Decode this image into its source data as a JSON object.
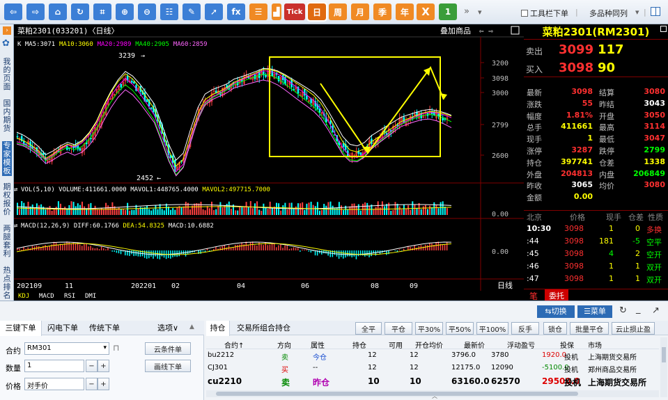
{
  "toolbar": {
    "buttons": [
      {
        "icon": "back-arrow-icon",
        "glyph": "⇦"
      },
      {
        "icon": "forward-arrow-icon",
        "glyph": "⇨"
      },
      {
        "icon": "home-icon",
        "glyph": "⌂"
      },
      {
        "icon": "refresh-icon",
        "glyph": "↻"
      },
      {
        "icon": "crop-icon",
        "glyph": "⌗"
      },
      {
        "icon": "zoom-in-icon",
        "glyph": "⊕"
      },
      {
        "icon": "zoom-out-icon",
        "glyph": "⊖"
      },
      {
        "icon": "formula-icon",
        "glyph": "☷"
      },
      {
        "icon": "draw-icon",
        "glyph": "✎"
      },
      {
        "icon": "cursor-icon",
        "glyph": "➚"
      },
      {
        "icon": "fx-icon",
        "glyph": "fx"
      },
      {
        "icon": "list-icon",
        "glyph": "☰"
      },
      {
        "icon": "chart-icon",
        "glyph": "▟"
      }
    ],
    "tick_label": "Tick",
    "periods": [
      "日",
      "周",
      "月",
      "季",
      "年"
    ],
    "x_label": "X",
    "one_label": "1",
    "more_label": "»",
    "more_dropdown": "▾",
    "toolbar_order": "工具栏下单",
    "multi_variety": "多品种同列",
    "multi_variety_dropdown": "▾"
  },
  "sidebar": {
    "items": [
      "我的页面",
      "国内期货",
      "专家模板",
      "期权报价",
      "两腿套利",
      "热点排名"
    ]
  },
  "chart": {
    "title": "菜粕2301(033201)〈日线〉",
    "overlay_label": "叠加商品",
    "ma_legend": [
      {
        "text": "K MA5:3071",
        "color": "#ffffff"
      },
      {
        "text": "MA10:3060",
        "color": "#ffff00"
      },
      {
        "text": "MA20:2989",
        "color": "#ff00ff"
      },
      {
        "text": "MA40:2905",
        "color": "#00ff00"
      },
      {
        "text": "MA60:2859",
        "color": "#ff66ff"
      }
    ],
    "high_label": "3239",
    "low_label": "2452",
    "price_ticks": [
      "3200",
      "3098",
      "3000",
      "2799",
      "2600"
    ],
    "vol_legend": [
      {
        "text": "VOL(5,10) VOLUME:411661.0000",
        "color": "#ffffff"
      },
      {
        "text": "MAVOL1:448765.4000",
        "color": "#ffffff"
      },
      {
        "text": "MAVOL2:497715.7000",
        "color": "#ffff00"
      }
    ],
    "vol_tick": "0.00",
    "macd_legend": [
      {
        "text": "MACD(12,26,9) DIFF:60.1766",
        "color": "#ffffff"
      },
      {
        "text": "DEA:54.8325",
        "color": "#ffff00"
      },
      {
        "text": "MACD:10.6882",
        "color": "#ffffff"
      }
    ],
    "macd_tick": "0.00",
    "x_labels": [
      "202109",
      "11",
      "202201",
      "02",
      "04",
      "06",
      "08",
      "09"
    ],
    "x_unit": "日线",
    "indicator_tabs": [
      "KDJ",
      "MACD",
      "RSI",
      "DMI"
    ]
  },
  "quote": {
    "name": "菜粕2301(RM2301)",
    "sell_label": "卖出",
    "sell_price": "3099",
    "sell_vol": "117",
    "buy_label": "买入",
    "buy_price": "3098",
    "buy_vol": "90",
    "rows": [
      [
        "最新",
        "3098",
        "结算",
        "3080"
      ],
      [
        "涨跌",
        "55",
        "昨结",
        "3043"
      ],
      [
        "幅度",
        "1.81%",
        "开盘",
        "3050"
      ],
      [
        "总手",
        "411661",
        "最高",
        "3114"
      ],
      [
        "现手",
        "1",
        "最低",
        "3047"
      ],
      [
        "涨停",
        "3287",
        "跌停",
        "2799"
      ],
      [
        "持仓",
        "397741",
        "仓差",
        "1338"
      ],
      [
        "外盘",
        "204813",
        "内盘",
        "206849"
      ],
      [
        "昨收",
        "3065",
        "均价",
        "3080"
      ],
      [
        "金额",
        "0.00",
        "",
        ""
      ]
    ],
    "tick_header": [
      "北京",
      "价格",
      "现手",
      "仓差",
      "性质"
    ],
    "ticks": [
      [
        "10:30",
        "3098",
        "1",
        "0",
        "多换"
      ],
      [
        ":44",
        "3098",
        "181",
        "-5",
        "空平"
      ],
      [
        ":45",
        "3098",
        "4",
        "2",
        "空开"
      ],
      [
        ":46",
        "3098",
        "1",
        "1",
        "双开"
      ],
      [
        ":47",
        "3098",
        "1",
        "1",
        "双开"
      ]
    ],
    "tab_pen": "笔",
    "tab_entrust": "委托"
  },
  "bottom": {
    "switch_label": "⇆切换",
    "menu_label": "☰菜单",
    "order_tabs": [
      "三键下单",
      "闪电下单",
      "传统下单"
    ],
    "options_label": "选项∨",
    "contract_label": "合约",
    "contract_value": "RM301",
    "qty_label": "数量",
    "qty_value": "1",
    "price_label": "价格",
    "price_value": "对手价",
    "cloud_order": "云条件单",
    "line_order": "画线下单",
    "pos_tabs": [
      "持仓",
      "交易所组合持仓"
    ],
    "actions": [
      "全平",
      "平仓",
      "平30%",
      "平50%",
      "平100%",
      "反手",
      "锁仓",
      "批量平仓",
      "云止损止盈"
    ],
    "headers": [
      "合约↑",
      "方向",
      "属性",
      "持仓",
      "可用",
      "开仓均价",
      "最新价",
      "浮动盈亏",
      "投保",
      "市场"
    ],
    "rows": [
      [
        "bu2212",
        "卖",
        "今仓",
        "12",
        "12",
        "3796.0",
        "3780",
        "1920.0",
        "投机",
        "上海期货交易所"
      ],
      [
        "CJ301",
        "买",
        "--",
        "12",
        "12",
        "12175.0",
        "12090",
        "-5100.0",
        "投机",
        "郑州商品交易所"
      ],
      [
        "cu2210",
        "卖",
        "昨仓",
        "10",
        "10",
        "63160.0",
        "62570",
        "29500.0",
        "投机",
        "上海期货交易所"
      ]
    ]
  }
}
